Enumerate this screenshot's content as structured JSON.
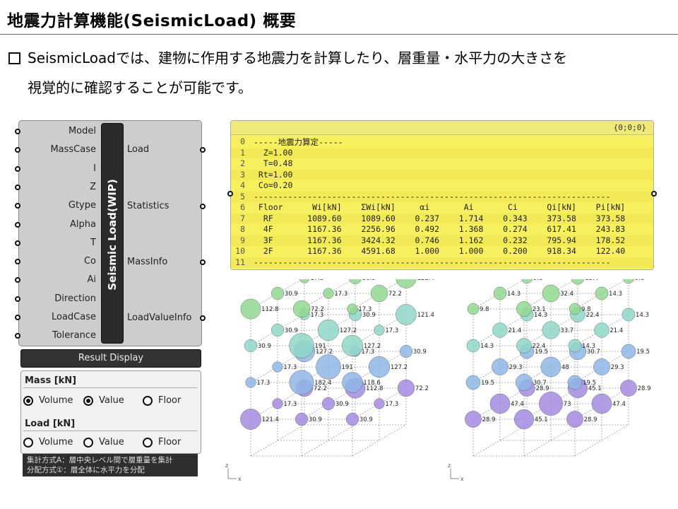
{
  "slide": {
    "title": "地震力計算機能(SeismicLoad) 概要",
    "bullet_line1": "SeismicLoadでは、建物に作用する地震力を計算したり、層重量・水平力の大きさを",
    "bullet_line2": "視覚的に確認することが可能です。"
  },
  "component": {
    "core_label": "Seismic Load(WIP)",
    "inputs": [
      "Model",
      "MassCase",
      "I",
      "Z",
      "Gtype",
      "Alpha",
      "T",
      "Co",
      "Ai",
      "Direction",
      "LoadCase",
      "Tolerance"
    ],
    "outputs": [
      "Load",
      "Statistics",
      "MassInfo",
      "LoadValueInfo"
    ],
    "button_label": "Result Display",
    "mass_header": "Mass [kN]",
    "load_header": "Load [kN]",
    "radio_volume": "Volume",
    "radio_value": "Value",
    "radio_floor": "Floor",
    "note_line1": "集計方式A：層中央レベル間で層重量を集計",
    "note_line2": "分配方式①：層全体に水平力を分配"
  },
  "panel": {
    "header": "{0;0;0}",
    "rows": [
      "-----地震力算定-----",
      "  Z=1.00",
      "  T=0.48",
      " Rt=1.00",
      " Co=0.20",
      "-------------------------------------------------------------------------",
      " Floor      Wi[kN]    ΣWi[kN]     αi       Ai       Ci      Qi[kN]    Pi[kN]",
      "  RF       1089.60    1089.60    0.237    1.714    0.343    373.58    373.58",
      "  4F       1167.36    2256.96    0.492    1.368    0.274    617.41    243.83",
      "  3F       1167.36    3424.32    0.746    1.162    0.232    795.94    178.52",
      "  2F       1167.36    4591.68    1.000    1.000    0.200    918.34    122.40",
      "-------------------------------------------------------------------------"
    ]
  },
  "viewports": {
    "left_labels": [
      "72.2",
      "112.8",
      "72.2",
      "17.3",
      "30.9",
      "17.3",
      "121.4",
      "30.9",
      "30.9",
      "127.2",
      "17.3",
      "30.9",
      "17.3",
      "191",
      "127.2",
      "17.3",
      "182.4",
      "118.6",
      "17.3",
      "30.9",
      "121.4",
      "30.9",
      "127.2",
      "17.3",
      "30.9",
      "191",
      "127.2",
      "17.3",
      "30.9",
      "121.4",
      "30.9",
      "17.3",
      "72.2",
      "112.8",
      "72.2",
      "17.3",
      "30.9",
      "17.3",
      "121.4",
      "30.9",
      "17.3",
      "30.9",
      "17.3",
      "30.9"
    ],
    "right_labels": [
      "28.9",
      "45.1",
      "28.9",
      "47.4",
      "73",
      "47.4",
      "28.9",
      "45.1",
      "28.9",
      "19.5",
      "30.7",
      "19.5",
      "29.3",
      "48",
      "29.3",
      "19.5",
      "30.7",
      "19.5",
      "14.3",
      "22.4",
      "14.3",
      "21.4",
      "33.7",
      "21.4",
      "14.3",
      "22.4",
      "14.3",
      "9.8",
      "15.4",
      "9.8",
      "14.3",
      "32.4",
      "14.3",
      "9.8",
      "23.1",
      "9.8",
      "14.7",
      "15.4",
      "9.8",
      "9.8",
      "14.7"
    ],
    "axis_x": "x",
    "axis_z": "z"
  },
  "colors": {
    "panel_yellow": "#f5f07a",
    "component_gray": "#cdcdcd"
  }
}
